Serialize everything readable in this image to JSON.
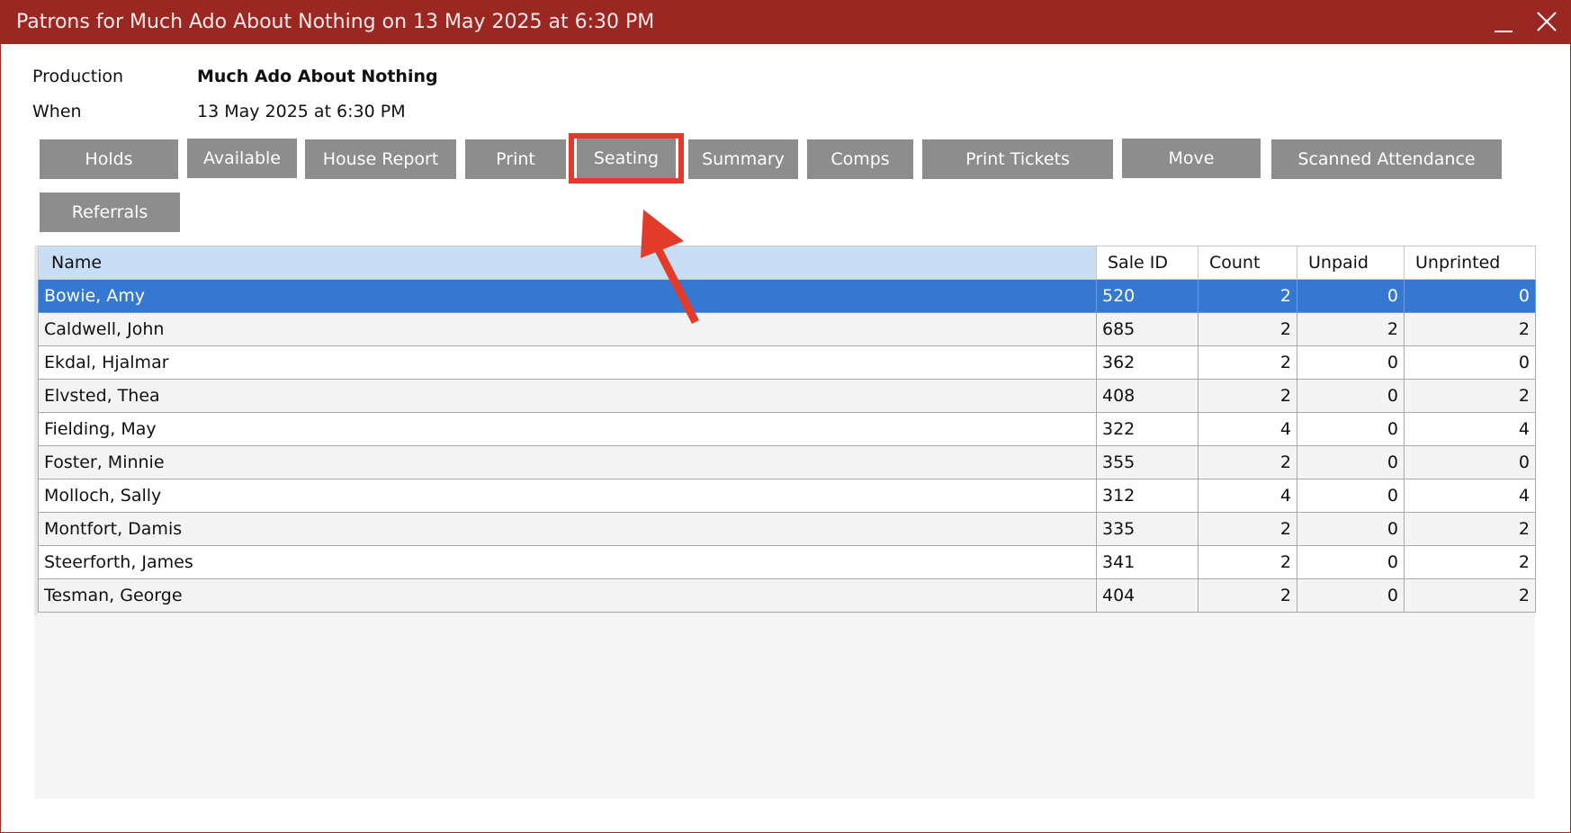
{
  "window": {
    "title": "Patrons for Much Ado About Nothing on 13 May 2025 at 6:30 PM",
    "minimize_glyph": "minimize-icon",
    "close_glyph": "close-icon"
  },
  "info": {
    "production_label": "Production",
    "production_value": "Much Ado About Nothing",
    "when_label": "When",
    "when_value": "13 May 2025 at 6:30 PM"
  },
  "buttons": {
    "holds": "Holds",
    "available": "Available",
    "house_report": "House Report",
    "print": "Print",
    "seating": "Seating",
    "summary": "Summary",
    "comps": "Comps",
    "print_tickets": "Print Tickets",
    "move": "Move",
    "scanned_attendance": "Scanned Attendance",
    "referrals": "Referrals"
  },
  "table": {
    "columns": [
      "Name",
      "Sale ID",
      "Count",
      "Unpaid",
      "Unprinted"
    ],
    "rows": [
      {
        "name": "Bowie, Amy",
        "sale_id": "520",
        "count": "2",
        "unpaid": "0",
        "unprinted": "0"
      },
      {
        "name": "Caldwell, John",
        "sale_id": "685",
        "count": "2",
        "unpaid": "2",
        "unprinted": "2"
      },
      {
        "name": "Ekdal, Hjalmar",
        "sale_id": "362",
        "count": "2",
        "unpaid": "0",
        "unprinted": "0"
      },
      {
        "name": "Elvsted, Thea",
        "sale_id": "408",
        "count": "2",
        "unpaid": "0",
        "unprinted": "2"
      },
      {
        "name": "Fielding, May",
        "sale_id": "322",
        "count": "4",
        "unpaid": "0",
        "unprinted": "4"
      },
      {
        "name": "Foster, Minnie",
        "sale_id": "355",
        "count": "2",
        "unpaid": "0",
        "unprinted": "0"
      },
      {
        "name": "Molloch, Sally",
        "sale_id": "312",
        "count": "4",
        "unpaid": "0",
        "unprinted": "4"
      },
      {
        "name": "Montfort, Damis",
        "sale_id": "335",
        "count": "2",
        "unpaid": "0",
        "unprinted": "2"
      },
      {
        "name": "Steerforth, James",
        "sale_id": "341",
        "count": "2",
        "unpaid": "0",
        "unprinted": "2"
      },
      {
        "name": "Tesman, George",
        "sale_id": "404",
        "count": "2",
        "unpaid": "0",
        "unprinted": "2"
      }
    ],
    "selected_row": 0
  },
  "colors": {
    "titlebar": "#9b2723",
    "button": "#8d8d8d",
    "selection": "#3478d2",
    "header_name": "#c7def5",
    "annotation": "#e23b2a"
  },
  "annotation": {
    "highlight_target": "seating-button",
    "arrow_icon": "arrow-up-left-icon"
  }
}
